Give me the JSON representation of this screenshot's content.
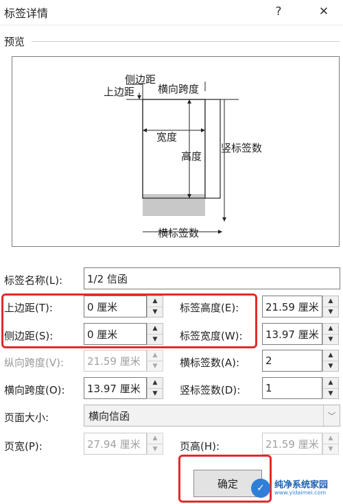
{
  "window": {
    "title": "标签详情",
    "help_icon": "?",
    "close_icon": "✕"
  },
  "preview": {
    "label": "预览",
    "diagram": {
      "side_margin": "侧边距",
      "top_margin": "上边距",
      "horizontal_pitch": "横向跨度",
      "width": "宽度",
      "height": "高度",
      "vertical_count": "竖标签数",
      "horizontal_count": "横标签数"
    }
  },
  "form": {
    "label_name": {
      "label": "标签名称(L):",
      "value": "1/2 信函"
    },
    "top_margin": {
      "label": "上边距(T):",
      "value": "0 厘米"
    },
    "label_height": {
      "label": "标签高度(E):",
      "value": "21.59 厘米"
    },
    "side_margin": {
      "label": "侧边距(S):",
      "value": "0 厘米"
    },
    "label_width": {
      "label": "标签宽度(W):",
      "value": "13.97 厘米"
    },
    "vertical_pitch": {
      "label": "纵向跨度(V):",
      "value": "21.59 厘米"
    },
    "labels_across": {
      "label": "横标签数(A):",
      "value": "2"
    },
    "horizontal_pitch": {
      "label": "横向跨度(O):",
      "value": "13.97 厘米"
    },
    "labels_down": {
      "label": "竖标签数(D):",
      "value": "1"
    },
    "page_size": {
      "label": "页面大小:",
      "value": "横向信函"
    },
    "page_width": {
      "label": "页宽(P):",
      "value": "27.94 厘米"
    },
    "page_height": {
      "label": "页高(H):",
      "value": "21.59 厘米"
    }
  },
  "buttons": {
    "ok": "确定"
  },
  "watermark": {
    "text": "纯净系统家园",
    "url": "www.yidaimei.com"
  },
  "colors": {
    "highlight": "#e02a2a",
    "label_fill": "#c8c8c8"
  }
}
